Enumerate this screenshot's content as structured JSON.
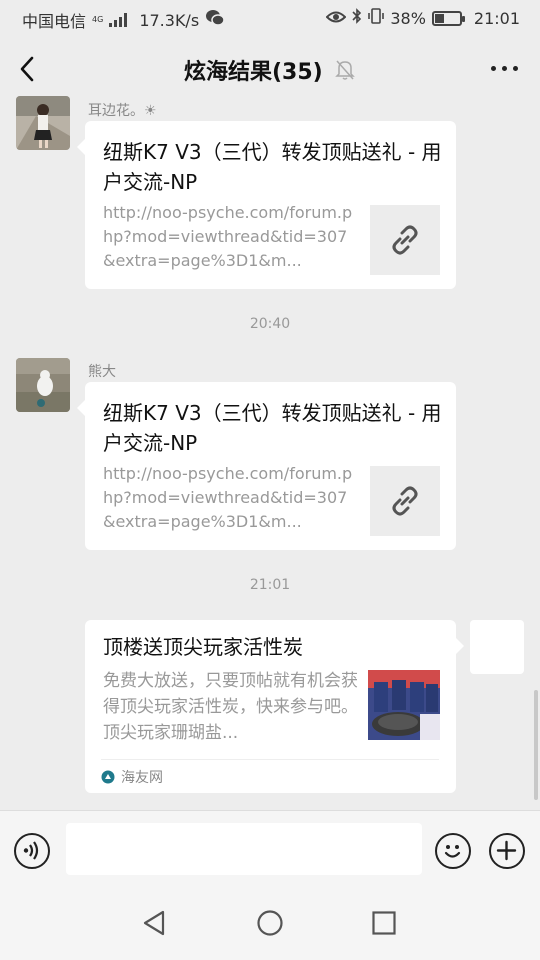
{
  "status_bar": {
    "carrier": "中国电信",
    "network_tag": "4G",
    "speed": "17.3K/s",
    "battery_percent": "38%",
    "battery_level": 0.38,
    "time": "21:01",
    "icons": [
      "signal-icon",
      "wechat-icon",
      "eye-icon",
      "bluetooth-icon",
      "vibrate-icon",
      "battery-icon"
    ]
  },
  "header": {
    "title": "炫海结果(35)",
    "muted_icon": "bell-off-icon",
    "back_icon": "chevron-left-icon",
    "more_icon": "more-dots-icon"
  },
  "messages": [
    {
      "sender": "耳边花。☀",
      "title": "纽斯K7 V3（三代）转发顶贴送礼 - 用户交流-NP",
      "desc": "http://noo-psyche.com/forum.php?mod=viewthread&tid=307&extra=page%3D1&m...",
      "thumb_icon": "link-icon"
    },
    {
      "timestamp": "20:40"
    },
    {
      "sender": "熊大",
      "title": "纽斯K7 V3（三代）转发顶贴送礼 - 用户交流-NP",
      "desc": "http://noo-psyche.com/forum.php?mod=viewthread&tid=307&extra=page%3D1&m...",
      "thumb_icon": "link-icon"
    },
    {
      "timestamp": "21:01"
    },
    {
      "title": "顶楼送顶尖玩家活性炭",
      "desc": "免费大放送，只要顶帖就有机会获得顶尖玩家活性炭，快来参与吧。顶尖玩家珊瑚盐...",
      "source": "海友网"
    }
  ],
  "input_bar": {
    "voice_icon": "voice-icon",
    "value": "",
    "emoji_icon": "emoji-icon",
    "plus_icon": "plus-icon"
  },
  "nav_bar": {
    "icons": [
      "back-triangle-icon",
      "home-circle-icon",
      "recents-square-icon"
    ]
  }
}
